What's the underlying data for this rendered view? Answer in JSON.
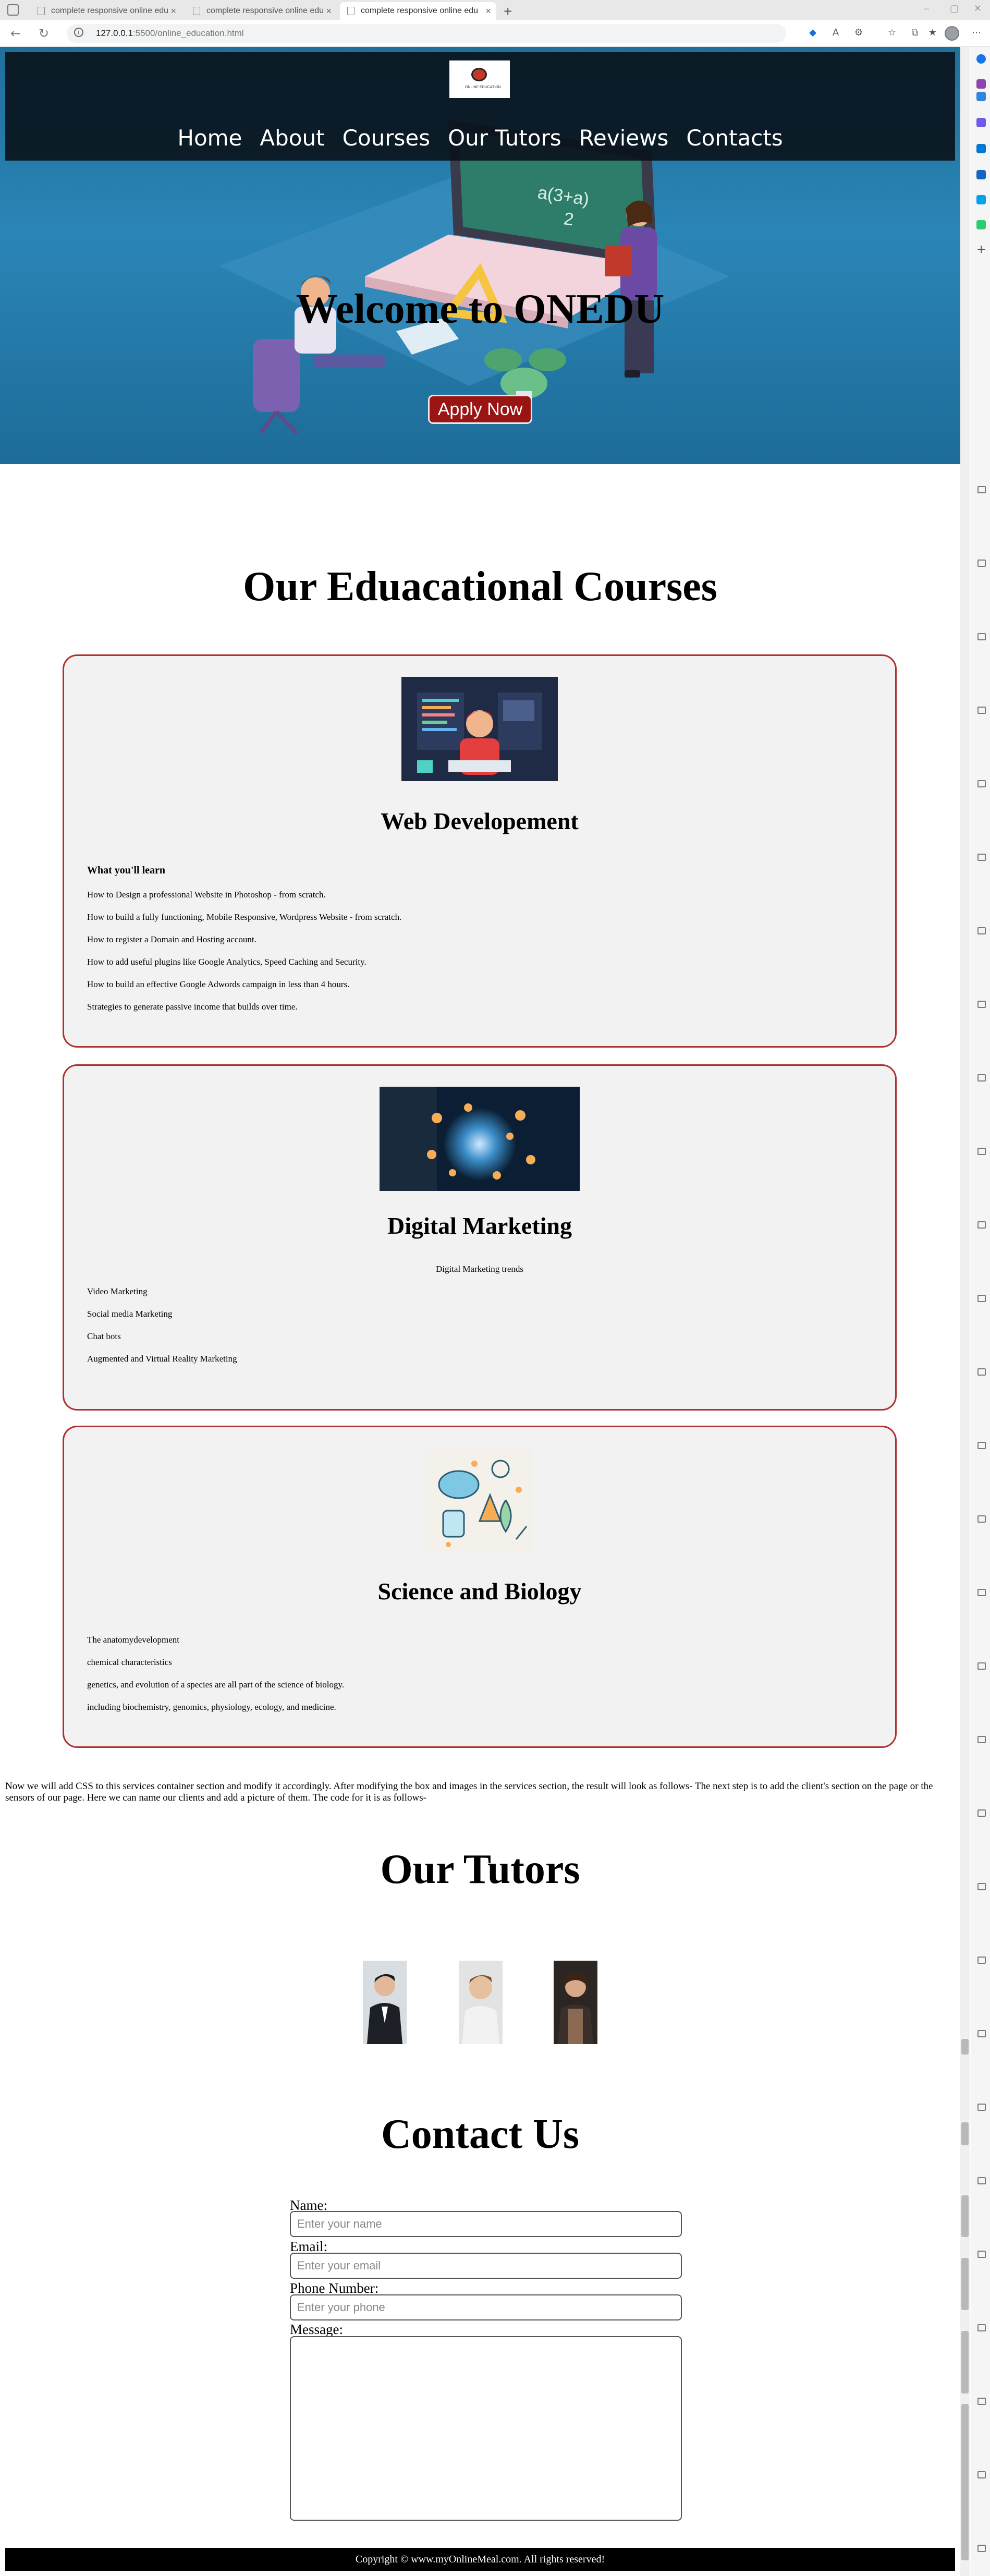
{
  "browser": {
    "tabs": [
      {
        "label": "complete responsive online edu"
      },
      {
        "label": "complete responsive online edu"
      },
      {
        "label": "complete responsive online edu"
      }
    ],
    "url": {
      "host": "127.0.0.1",
      "path": ":5500/online_education.html"
    }
  },
  "nav": {
    "logo_text": "ONLINE EDUCATION",
    "items": [
      "Home",
      "About",
      "Courses",
      "Our Tutors",
      "Reviews",
      "Contacts"
    ]
  },
  "hero": {
    "title": "Welcome to ONEDU",
    "apply_label": "Apply Now"
  },
  "courses": {
    "title": "Our Eduacational Courses",
    "web": {
      "title": "Web Developement",
      "subtitle": "What you'll learn",
      "items": [
        "How to Design a professional Website in Photoshop - from scratch.",
        "How to build a fully functioning, Mobile Responsive, Wordpress Website - from scratch.",
        "How to register a Domain and Hosting account.",
        "How to add useful plugins like Google Analytics, Speed Caching and Security.",
        "How to build an effective Google Adwords campaign in less than 4 hours.",
        "Strategies to generate passive income that builds over time."
      ]
    },
    "marketing": {
      "title": "Digital Marketing",
      "subtitle": "Digital Marketing trends",
      "items": [
        "Video Marketing",
        "Social media Marketing",
        "Chat bots",
        "Augmented and Virtual Reality Marketing"
      ]
    },
    "biology": {
      "title": "Science and Biology",
      "items": [
        "The anatomydevelopment",
        "chemical characteristics",
        "genetics, and evolution of a species are all part of the science of biology.",
        "including biochemistry, genomics, physiology, ecology, and medicine."
      ]
    }
  },
  "note": "Now we will add CSS to this services container section and modify it accordingly. After modifying the box and images in the services section, the result will look as follows- The next step is to add the client's section on the page or the sensors of our page. Here we can name our clients and add a picture of them. The code for it is as follows-",
  "tutors": {
    "title": "Our Tutors"
  },
  "contact": {
    "title": "Contact Us",
    "name_label": "Name:",
    "name_placeholder": "Enter your name",
    "email_label": "Email:",
    "email_placeholder": "Enter your email",
    "phone_label": "Phone Number:",
    "phone_placeholder": "Enter your phone",
    "message_label": "Message:"
  },
  "footer": {
    "text": "Copyright © www.myOnlineMeal.com. All rights reserved!"
  },
  "colors": {
    "hero_blue": "#2a85b6",
    "card_border": "#b03030",
    "apply_button": "#9a1414"
  }
}
